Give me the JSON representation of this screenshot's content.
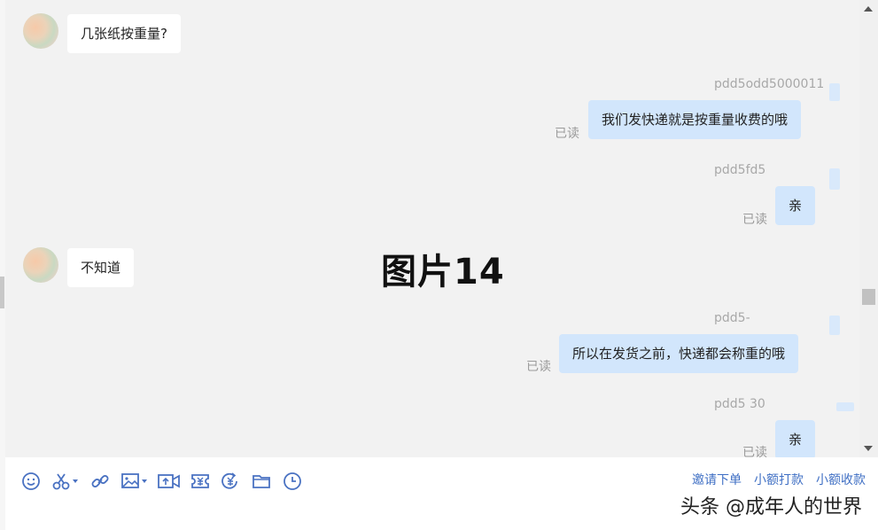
{
  "messages": {
    "m1": {
      "text": "几张纸按重量?"
    },
    "m2": {
      "sender": "pdd5odd5000011",
      "text": "我们发快递就是按重量收费的哦",
      "status": "已读"
    },
    "m3": {
      "sender": "pdd5fd5",
      "text": "亲",
      "status": "已读"
    },
    "m4": {
      "text": "不知道"
    },
    "m5": {
      "sender": "pdd5-",
      "text": "所以在发货之前，快递都会称重的哦",
      "status": "已读"
    },
    "m6": {
      "sender": "pdd5     30",
      "text": "亲",
      "status": "已读"
    }
  },
  "overlay": {
    "label": "图片14"
  },
  "toolbar": {
    "icons": [
      "emoji-icon",
      "scissors-icon",
      "link-icon",
      "image-icon",
      "video-icon",
      "coupon-icon",
      "refund-icon",
      "folder-icon",
      "clock-icon"
    ],
    "links": {
      "invite_order": "邀请下单",
      "small_pay": "小额打款",
      "small_collect": "小额收款"
    }
  },
  "credit": "头条 @成年人的世界",
  "colors": {
    "chat_bg": "#f2f2f2",
    "outgoing_bubble": "#d2e6fc",
    "incoming_bubble": "#ffffff",
    "link": "#3f6fc4",
    "icon": "#4a72c2"
  }
}
